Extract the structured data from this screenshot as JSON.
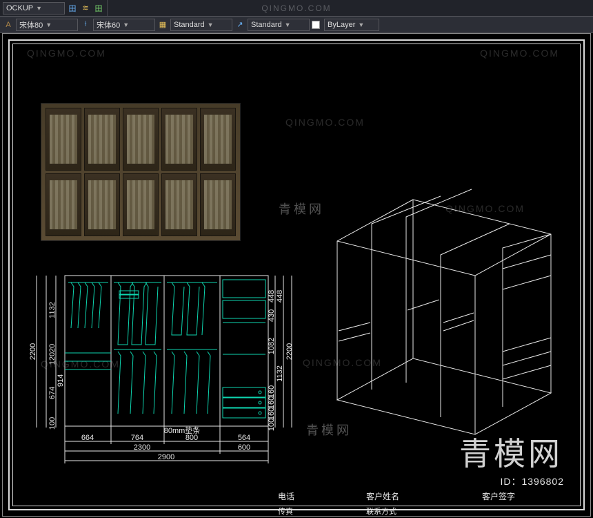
{
  "topbar": {
    "watermark": "QINGMO.COM",
    "left_label": "OCKUP",
    "font1": "宋体80",
    "font2": "宋体60",
    "std1": "Standard",
    "std2": "Standard",
    "bylayer": "ByLayer"
  },
  "watermarks": {
    "site_en": "QINGMO.COM",
    "site_cn_small": "青模网",
    "site_cn_big": "青模网",
    "id_label": "ID：1396802"
  },
  "elevation": {
    "note": "80mm垫条",
    "h_dims_row1": [
      "664",
      "764",
      "800",
      "564"
    ],
    "h_dims_row2": [
      "2300",
      "600"
    ],
    "h_dims_row3": "2900",
    "v_left": [
      "100",
      "674",
      "12020",
      "1132",
      "2200"
    ],
    "v_left_inner": "914",
    "v_right": [
      "100",
      "160",
      "160",
      "160",
      "1132",
      "1082",
      "430",
      "448",
      "448",
      "2200"
    ]
  },
  "titleblock": {
    "c1": "电话",
    "c2": "客户姓名",
    "c3": "客户签字",
    "r2c1": "传真",
    "r2c2": "联系方式"
  }
}
